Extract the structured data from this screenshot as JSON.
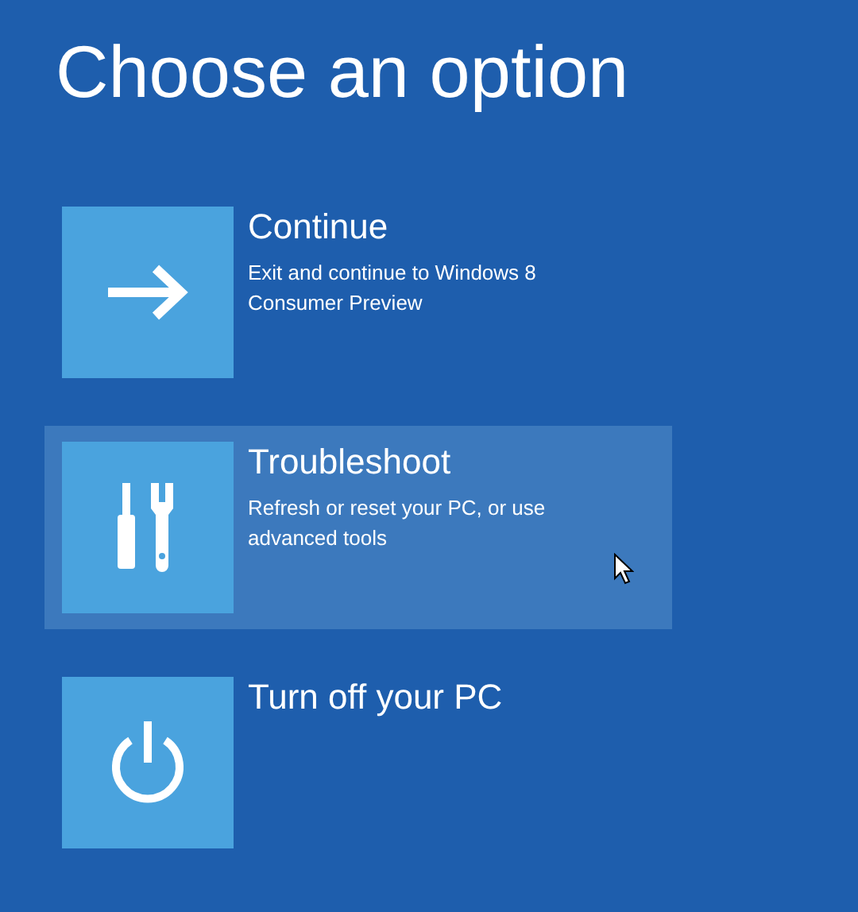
{
  "title": "Choose an option",
  "options": [
    {
      "kind": "arrow",
      "label": "Continue",
      "description": "Exit and continue to Windows 8 Consumer Preview",
      "selected": false
    },
    {
      "kind": "tools",
      "label": "Troubleshoot",
      "description": "Refresh or reset your PC, or use advanced tools",
      "selected": true
    },
    {
      "kind": "power",
      "label": "Turn off your PC",
      "selected": false
    }
  ]
}
